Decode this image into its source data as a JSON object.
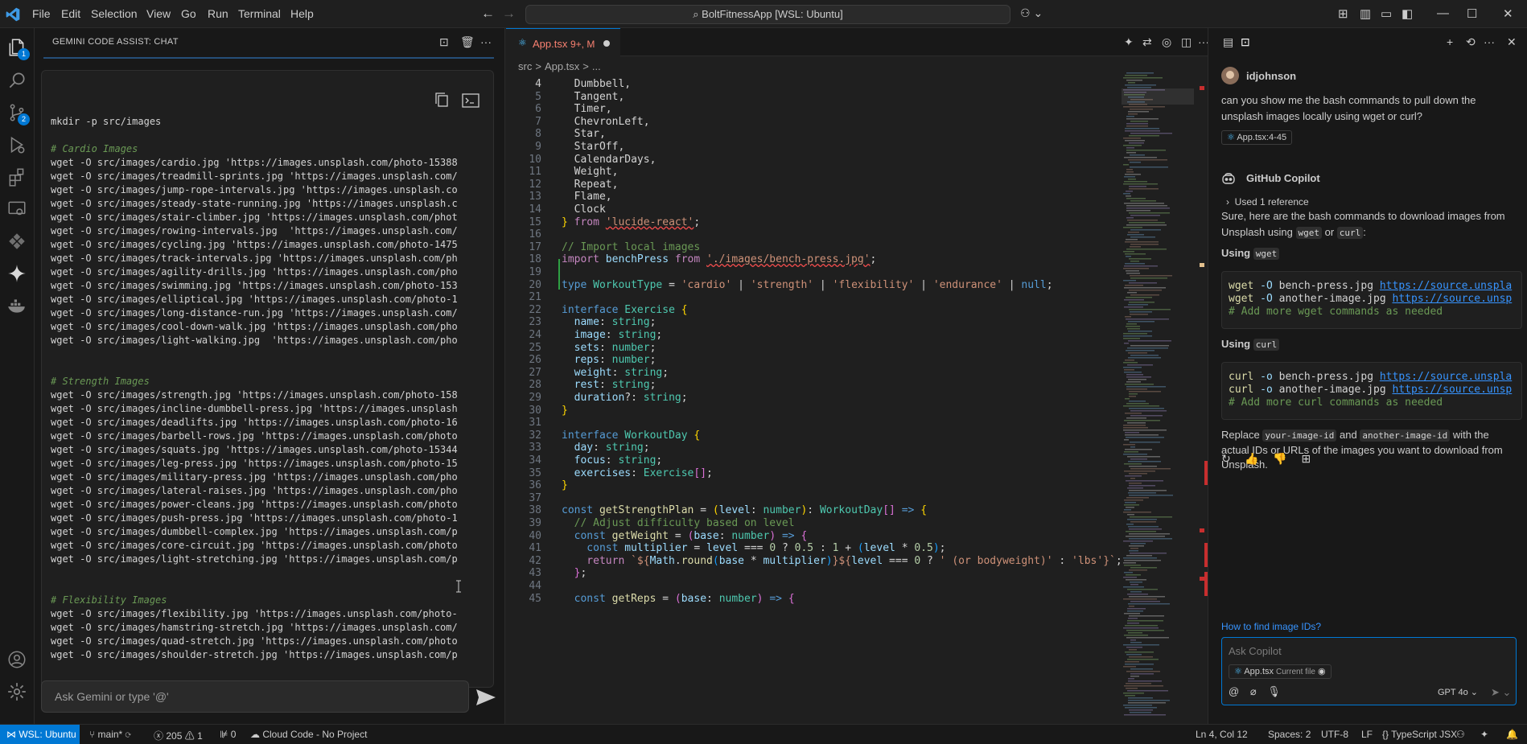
{
  "titlebar": {
    "menus": [
      "File",
      "Edit",
      "Selection",
      "View",
      "Go",
      "Run",
      "Terminal",
      "Help"
    ],
    "command_center": "BoltFitnessApp [WSL: Ubuntu]"
  },
  "activity": {
    "badges": {
      "explorer": "1",
      "scm": "2"
    }
  },
  "gemini": {
    "title": "GEMINI CODE ASSIST: CHAT",
    "code_lines": [
      {
        "t": "mkdir -p src/images",
        "c": false
      },
      {
        "t": "",
        "c": false
      },
      {
        "t": "# Cardio Images",
        "c": true
      },
      {
        "t": "wget -O src/images/cardio.jpg 'https://images.unsplash.com/photo-15388",
        "c": false
      },
      {
        "t": "wget -O src/images/treadmill-sprints.jpg 'https://images.unsplash.com/",
        "c": false
      },
      {
        "t": "wget -O src/images/jump-rope-intervals.jpg 'https://images.unsplash.co",
        "c": false
      },
      {
        "t": "wget -O src/images/steady-state-running.jpg 'https://images.unsplash.c",
        "c": false
      },
      {
        "t": "wget -O src/images/stair-climber.jpg 'https://images.unsplash.com/phot",
        "c": false
      },
      {
        "t": "wget -O src/images/rowing-intervals.jpg  'https://images.unsplash.com/",
        "c": false
      },
      {
        "t": "wget -O src/images/cycling.jpg 'https://images.unsplash.com/photo-1475",
        "c": false
      },
      {
        "t": "wget -O src/images/track-intervals.jpg 'https://images.unsplash.com/ph",
        "c": false
      },
      {
        "t": "wget -O src/images/agility-drills.jpg 'https://images.unsplash.com/pho",
        "c": false
      },
      {
        "t": "wget -O src/images/swimming.jpg 'https://images.unsplash.com/photo-153",
        "c": false
      },
      {
        "t": "wget -O src/images/elliptical.jpg 'https://images.unsplash.com/photo-1",
        "c": false
      },
      {
        "t": "wget -O src/images/long-distance-run.jpg 'https://images.unsplash.com/",
        "c": false
      },
      {
        "t": "wget -O src/images/cool-down-walk.jpg 'https://images.unsplash.com/pho",
        "c": false
      },
      {
        "t": "wget -O src/images/light-walking.jpg  'https://images.unsplash.com/pho",
        "c": false
      },
      {
        "t": "",
        "c": false
      },
      {
        "t": "",
        "c": false
      },
      {
        "t": "# Strength Images",
        "c": true
      },
      {
        "t": "wget -O src/images/strength.jpg 'https://images.unsplash.com/photo-158",
        "c": false
      },
      {
        "t": "wget -O src/images/incline-dumbbell-press.jpg 'https://images.unsplash",
        "c": false
      },
      {
        "t": "wget -O src/images/deadlifts.jpg 'https://images.unsplash.com/photo-16",
        "c": false
      },
      {
        "t": "wget -O src/images/barbell-rows.jpg 'https://images.unsplash.com/photo",
        "c": false
      },
      {
        "t": "wget -O src/images/squats.jpg 'https://images.unsplash.com/photo-15344",
        "c": false
      },
      {
        "t": "wget -O src/images/leg-press.jpg 'https://images.unsplash.com/photo-15",
        "c": false
      },
      {
        "t": "wget -O src/images/military-press.jpg 'https://images.unsplash.com/pho",
        "c": false
      },
      {
        "t": "wget -O src/images/lateral-raises.jpg 'https://images.unsplash.com/pho",
        "c": false
      },
      {
        "t": "wget -O src/images/power-cleans.jpg 'https://images.unsplash.com/photo",
        "c": false
      },
      {
        "t": "wget -O src/images/push-press.jpg 'https://images.unsplash.com/photo-1",
        "c": false
      },
      {
        "t": "wget -O src/images/dumbbell-complex.jpg 'https://images.unsplash.com/p",
        "c": false
      },
      {
        "t": "wget -O src/images/core-circuit.jpg 'https://images.unsplash.com/photo",
        "c": false
      },
      {
        "t": "wget -O src/images/light-stretching.jpg 'https://images.unsplash.com/p",
        "c": false
      },
      {
        "t": "",
        "c": false
      },
      {
        "t": "",
        "c": false
      },
      {
        "t": "# Flexibility Images",
        "c": true
      },
      {
        "t": "wget -O src/images/flexibility.jpg 'https://images.unsplash.com/photo-",
        "c": false
      },
      {
        "t": "wget -O src/images/hamstring-stretch.jpg 'https://images.unsplash.com/",
        "c": false
      },
      {
        "t": "wget -O src/images/quad-stretch.jpg 'https://images.unsplash.com/photo",
        "c": false
      },
      {
        "t": "wget -O src/images/shoulder-stretch.jpg 'https://images.unsplash.com/p",
        "c": false
      }
    ],
    "input_placeholder": "Ask Gemini or type '@'"
  },
  "editor": {
    "tab_label": "App.tsx",
    "tab_status": "9+, M",
    "breadcrumb": [
      "src",
      ">",
      "App.tsx",
      ">",
      "..."
    ],
    "lines": [
      {
        "n": "4",
        "h": [
          [
            "pu",
            "  Dumbbell,"
          ]
        ]
      },
      {
        "n": "5",
        "h": [
          [
            "pu",
            "  Tangent,"
          ]
        ]
      },
      {
        "n": "6",
        "h": [
          [
            "pu",
            "  Timer,"
          ]
        ]
      },
      {
        "n": "7",
        "h": [
          [
            "pu",
            "  ChevronLeft,"
          ]
        ]
      },
      {
        "n": "8",
        "h": [
          [
            "pu",
            "  Star,"
          ]
        ]
      },
      {
        "n": "9",
        "h": [
          [
            "pu",
            "  StarOff,"
          ]
        ]
      },
      {
        "n": "10",
        "h": [
          [
            "pu",
            "  CalendarDays,"
          ]
        ]
      },
      {
        "n": "11",
        "h": [
          [
            "pu",
            "  Weight,"
          ]
        ]
      },
      {
        "n": "12",
        "h": [
          [
            "pu",
            "  Repeat,"
          ]
        ]
      },
      {
        "n": "13",
        "h": [
          [
            "pu",
            "  Flame,"
          ]
        ]
      },
      {
        "n": "14",
        "h": [
          [
            "pu",
            "  Clock"
          ]
        ]
      },
      {
        "n": "15",
        "h": [
          [
            "br",
            "}"
          ],
          [
            "kw2",
            " from "
          ],
          [
            "str squig",
            "'lucide-react'"
          ],
          [
            "pu",
            ";"
          ]
        ]
      },
      {
        "n": "16",
        "h": []
      },
      {
        "n": "17",
        "h": [
          [
            "c",
            "// Import local images"
          ]
        ]
      },
      {
        "n": "18",
        "h": [
          [
            "kw2",
            "import "
          ],
          [
            "var",
            "benchPress "
          ],
          [
            "kw2",
            "from "
          ],
          [
            "str squig",
            "'./images/bench-press.jpg'"
          ],
          [
            "pu",
            ";"
          ]
        ]
      },
      {
        "n": "19",
        "h": []
      },
      {
        "n": "20",
        "h": [
          [
            "kw",
            "type "
          ],
          [
            "ty",
            "WorkoutType "
          ],
          [
            "pu",
            "= "
          ],
          [
            "str",
            "'cardio'"
          ],
          [
            "pu",
            " | "
          ],
          [
            "str",
            "'strength'"
          ],
          [
            "pu",
            " | "
          ],
          [
            "str",
            "'flexibility'"
          ],
          [
            "pu",
            " | "
          ],
          [
            "str",
            "'endurance'"
          ],
          [
            "pu",
            " | "
          ],
          [
            "kw",
            "null"
          ],
          [
            "pu",
            ";"
          ]
        ]
      },
      {
        "n": "21",
        "h": []
      },
      {
        "n": "22",
        "h": [
          [
            "kw",
            "interface "
          ],
          [
            "ty",
            "Exercise "
          ],
          [
            "br",
            "{"
          ]
        ]
      },
      {
        "n": "23",
        "h": [
          [
            "var",
            "  name"
          ],
          [
            "pu",
            ": "
          ],
          [
            "ty",
            "string"
          ],
          [
            "pu",
            ";"
          ]
        ]
      },
      {
        "n": "24",
        "h": [
          [
            "var",
            "  image"
          ],
          [
            "pu",
            ": "
          ],
          [
            "ty",
            "string"
          ],
          [
            "pu",
            ";"
          ]
        ]
      },
      {
        "n": "25",
        "h": [
          [
            "var",
            "  sets"
          ],
          [
            "pu",
            ": "
          ],
          [
            "ty",
            "number"
          ],
          [
            "pu",
            ";"
          ]
        ]
      },
      {
        "n": "26",
        "h": [
          [
            "var",
            "  reps"
          ],
          [
            "pu",
            ": "
          ],
          [
            "ty",
            "number"
          ],
          [
            "pu",
            ";"
          ]
        ]
      },
      {
        "n": "27",
        "h": [
          [
            "var",
            "  weight"
          ],
          [
            "pu",
            ": "
          ],
          [
            "ty",
            "string"
          ],
          [
            "pu",
            ";"
          ]
        ]
      },
      {
        "n": "28",
        "h": [
          [
            "var",
            "  rest"
          ],
          [
            "pu",
            ": "
          ],
          [
            "ty",
            "string"
          ],
          [
            "pu",
            ";"
          ]
        ]
      },
      {
        "n": "29",
        "h": [
          [
            "var",
            "  duration"
          ],
          [
            "pu",
            "?: "
          ],
          [
            "ty",
            "string"
          ],
          [
            "pu",
            ";"
          ]
        ]
      },
      {
        "n": "30",
        "h": [
          [
            "br",
            "}"
          ]
        ]
      },
      {
        "n": "31",
        "h": []
      },
      {
        "n": "32",
        "h": [
          [
            "kw",
            "interface "
          ],
          [
            "ty",
            "WorkoutDay "
          ],
          [
            "br",
            "{"
          ]
        ]
      },
      {
        "n": "33",
        "h": [
          [
            "var",
            "  day"
          ],
          [
            "pu",
            ": "
          ],
          [
            "ty",
            "string"
          ],
          [
            "pu",
            ";"
          ]
        ]
      },
      {
        "n": "34",
        "h": [
          [
            "var",
            "  focus"
          ],
          [
            "pu",
            ": "
          ],
          [
            "ty",
            "string"
          ],
          [
            "pu",
            ";"
          ]
        ]
      },
      {
        "n": "35",
        "h": [
          [
            "var",
            "  exercises"
          ],
          [
            "pu",
            ": "
          ],
          [
            "ty",
            "Exercise"
          ],
          [
            "br2",
            "[]"
          ],
          [
            "pu",
            ";"
          ]
        ]
      },
      {
        "n": "36",
        "h": [
          [
            "br",
            "}"
          ]
        ]
      },
      {
        "n": "37",
        "h": []
      },
      {
        "n": "38",
        "h": [
          [
            "kw",
            "const "
          ],
          [
            "fn",
            "getStrengthPlan "
          ],
          [
            "pu",
            "= "
          ],
          [
            "br",
            "("
          ],
          [
            "var",
            "level"
          ],
          [
            "pu",
            ": "
          ],
          [
            "ty",
            "number"
          ],
          [
            "br",
            ")"
          ],
          [
            "pu",
            ": "
          ],
          [
            "ty",
            "WorkoutDay"
          ],
          [
            "br2",
            "[]"
          ],
          [
            "kw",
            " => "
          ],
          [
            "br",
            "{"
          ]
        ]
      },
      {
        "n": "39",
        "h": [
          [
            "c",
            "  // Adjust difficulty based on level"
          ]
        ]
      },
      {
        "n": "40",
        "h": [
          [
            "kw",
            "  const "
          ],
          [
            "fn",
            "getWeight "
          ],
          [
            "pu",
            "= "
          ],
          [
            "br2",
            "("
          ],
          [
            "var",
            "base"
          ],
          [
            "pu",
            ": "
          ],
          [
            "ty",
            "number"
          ],
          [
            "br2",
            ")"
          ],
          [
            "kw",
            " => "
          ],
          [
            "br2",
            "{"
          ]
        ]
      },
      {
        "n": "41",
        "h": [
          [
            "kw",
            "    const "
          ],
          [
            "var",
            "multiplier "
          ],
          [
            "pu",
            "= "
          ],
          [
            "var",
            "level "
          ],
          [
            "pu",
            "=== "
          ],
          [
            "num",
            "0 "
          ],
          [
            "pu",
            "? "
          ],
          [
            "num",
            "0.5 "
          ],
          [
            "pu",
            ": "
          ],
          [
            "num",
            "1 "
          ],
          [
            "pu",
            "+ "
          ],
          [
            "br3",
            "("
          ],
          [
            "var",
            "level "
          ],
          [
            "pu",
            "* "
          ],
          [
            "num",
            "0.5"
          ],
          [
            "br3",
            ")"
          ],
          [
            "pu",
            ";"
          ]
        ]
      },
      {
        "n": "42",
        "h": [
          [
            "kw2",
            "    return "
          ],
          [
            "str",
            "`${"
          ],
          [
            "var",
            "Math"
          ],
          [
            "pu",
            "."
          ],
          [
            "fn",
            "round"
          ],
          [
            "br3",
            "("
          ],
          [
            "var",
            "base "
          ],
          [
            "pu",
            "* "
          ],
          [
            "var",
            "multiplier"
          ],
          [
            "br3",
            ")"
          ],
          [
            "str",
            "}${"
          ],
          [
            "var",
            "level "
          ],
          [
            "pu",
            "=== "
          ],
          [
            "num",
            "0 "
          ],
          [
            "pu",
            "? "
          ],
          [
            "str",
            "' (or bodyweight)' "
          ],
          [
            "pu",
            ": "
          ],
          [
            "str",
            "'lbs'"
          ],
          [
            "str",
            "}`"
          ],
          [
            "pu",
            ";"
          ]
        ]
      },
      {
        "n": "43",
        "h": [
          [
            "br2",
            "  }"
          ],
          [
            "pu",
            ";"
          ]
        ]
      },
      {
        "n": "44",
        "h": []
      },
      {
        "n": "45",
        "h": [
          [
            "kw",
            "  const "
          ],
          [
            "fn",
            "getReps "
          ],
          [
            "pu",
            "= "
          ],
          [
            "br2",
            "("
          ],
          [
            "var",
            "base"
          ],
          [
            "pu",
            ": "
          ],
          [
            "ty",
            "number"
          ],
          [
            "br2",
            ")"
          ],
          [
            "kw",
            " => "
          ],
          [
            "br2",
            "{"
          ]
        ]
      }
    ]
  },
  "copilot": {
    "user": "idjohnson",
    "question": "can you show me the bash commands to pull down the unsplash images locally using wget or curl?",
    "question_ref": "App.tsx:4-45",
    "assistant": "GitHub Copilot",
    "used_ref": "Used 1 reference",
    "intro_pre": "Sure, here are the bash commands to download images from Unsplash using ",
    "intro_c1": "wget",
    "intro_mid": " or ",
    "intro_c2": "curl",
    "intro_post": ":",
    "using": "Using",
    "h1_code": "wget",
    "h2_code": "curl",
    "wget_block": [
      {
        "cmd": "wget",
        "opt": " -O ",
        "file": "bench-press.jpg ",
        "url": "https://source.unspla"
      },
      {
        "cmd": "wget",
        "opt": " -O ",
        "file": "another-image.jpg ",
        "url": "https://source.unsp"
      }
    ],
    "wget_comment": "# Add more wget commands as needed",
    "curl_block": [
      {
        "cmd": "curl",
        "opt": " -o ",
        "file": "bench-press.jpg ",
        "url": "https://source.unspla"
      },
      {
        "cmd": "curl",
        "opt": " -o ",
        "file": "another-image.jpg ",
        "url": "https://source.unsp"
      }
    ],
    "curl_comment": "# Add more curl commands as needed",
    "replace_pre": "Replace ",
    "replace_c1": "your-image-id",
    "replace_mid": " and ",
    "replace_c2": "another-image-id",
    "replace_post": " with the actual IDs or URLs of the images you want to download from Unsplash.",
    "followup": "How to find image IDs?",
    "ask_placeholder": "Ask Copilot",
    "ask_file": "App.tsx",
    "ask_file_note": "Current file",
    "model": "GPT 4o"
  },
  "status": {
    "remote": "WSL: Ubuntu",
    "branch": "main*",
    "errors": "205",
    "warnings": "1",
    "ports": "0",
    "cloud": "Cloud Code - No Project",
    "cursor": "Ln 4, Col 12",
    "spaces": "Spaces: 2",
    "encoding": "UTF-8",
    "eol": "LF",
    "language": "TypeScript JSX"
  }
}
